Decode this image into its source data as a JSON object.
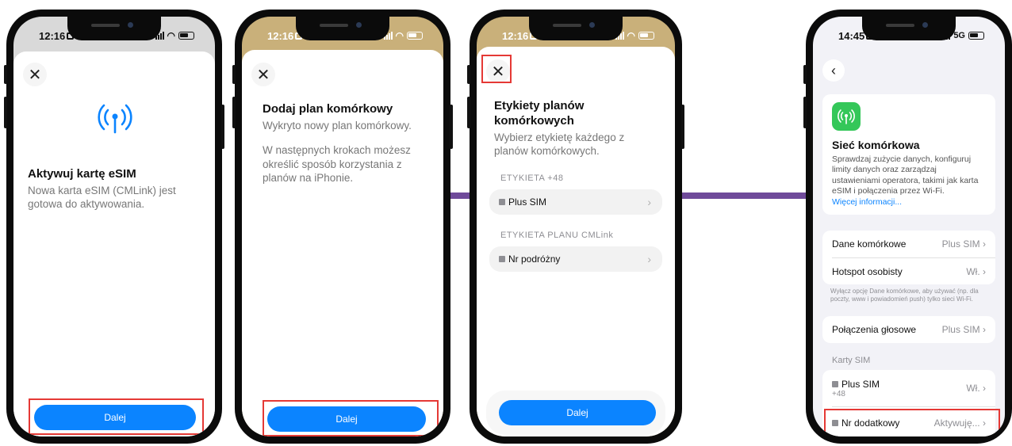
{
  "phone1": {
    "status_time": "12:16",
    "title": "Aktywuj kartę eSIM",
    "description": "Nowa karta eSIM (CMLink) jest gotowa do aktywowania.",
    "button": "Dalej"
  },
  "phone2": {
    "status_time": "12:16",
    "title": "Dodaj plan komórkowy",
    "subtitle": "Wykryto nowy plan komórkowy.",
    "description": "W następnych krokach możesz określić sposób korzystania z planów na iPhonie.",
    "button": "Dalej"
  },
  "phone3": {
    "status_time": "12:16",
    "title": "Etykiety planów komórkowych",
    "subtitle": "Wybierz etykietę każdego z planów komórkowych.",
    "section1_label": "ETYKIETA +48",
    "section1_value": "Plus SIM",
    "section2_label": "ETYKIETA PLANU CMLink",
    "section2_value": "Nr podróżny",
    "button": "Dalej"
  },
  "phone4": {
    "status_time": "14:45",
    "network": "5G",
    "title": "Sieć komórkowa",
    "description": "Sprawdzaj zużycie danych, konfiguruj limity danych oraz zarządzaj ustawieniami operatora, takimi jak karta eSIM i połączenia przez Wi-Fi.",
    "more_link": "Więcej informacji...",
    "rows": [
      {
        "label": "Dane komórkowe",
        "value": "Plus SIM"
      },
      {
        "label": "Hotspot osobisty",
        "value": "Wł."
      }
    ],
    "footnote": "Wyłącz opcję Dane komórkowe, aby używać (np. dla poczty, www i powiadomień push) tylko sieci Wi-Fi.",
    "voice_label": "Połączenia głosowe",
    "voice_value": "Plus SIM",
    "sim_section": "Karty SIM",
    "sim1_name": "Plus SIM",
    "sim1_number": "+48",
    "sim1_value": "Wł.",
    "sim2_name": "Nr dodatkowy",
    "sim2_value": "Aktywuję..."
  },
  "colors": {
    "accent": "#0b84ff",
    "highlight": "#e53935",
    "connector": "#6f4a9a",
    "cellular_green": "#34c759",
    "status_gold": "#c9b07a"
  }
}
